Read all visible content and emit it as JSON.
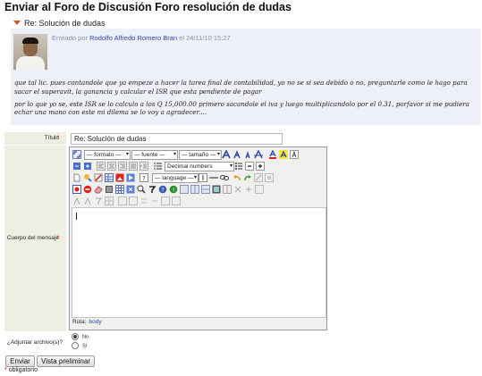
{
  "page": {
    "title": "Enviar al Foro de Discusión Foro resolución de dudas"
  },
  "post": {
    "subject": "Re: Solución de dudas",
    "sent_by_prefix": "Enviado por",
    "author": "Rodolfo Alfredo Romero Bran",
    "date_prefix": "el",
    "date": "24/11/10 15:27",
    "paragraph1": "que tal lic. pues contandole que ya empeze a hacer la tarea final de contabilidad, yo no se si sea debido o no, preguntarle como le hago para sacar el superavit, la ganancia y calcular el ISR que esta pendiente de pagar",
    "paragraph2": "por lo que yo se, este ISR se lo calculo a los Q 15,000.00 primero sacandole el iva y luego multiplicandolo por el 0.31, porfavor si me pudiera echar una mano con este mi dilema se lo voy a agradecer...."
  },
  "form": {
    "title_label": "Título",
    "title_value": "Re: Solución de dudas",
    "body_label": "Cuerpo del mensaje",
    "attach_label": "¿Adjuntar archivo(s)?",
    "attach_options": [
      "No",
      "Sí"
    ],
    "attach_selected": "No",
    "required_mark": "*"
  },
  "editor": {
    "format_select": "— formato —",
    "font_select": "— fuente —",
    "size_select": "— tamaño —",
    "list_select": "Decimal numbers",
    "language_select": "— language —",
    "path_label": "Ruta:",
    "path_value": "body"
  },
  "buttons": {
    "send": "Enviar",
    "preview": "Vista preliminar"
  },
  "footer": {
    "required_note": "obligatorio"
  },
  "colors": {
    "accent_link": "#2b45a8",
    "required": "#cc0000",
    "post_background": "#eef0f8",
    "label_background": "#ecefe2"
  }
}
